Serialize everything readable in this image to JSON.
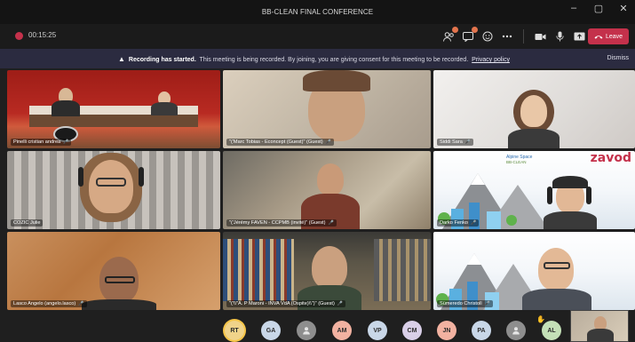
{
  "window": {
    "title": "BB-CLEAN FINAL CONFERENCE",
    "controls": [
      "–",
      "▢",
      "✕"
    ]
  },
  "toolbar": {
    "timer": "00:15:25",
    "icons": [
      "participants-icon",
      "chat-icon",
      "reactions-icon",
      "more-icon",
      "camera-icon",
      "mic-icon",
      "share-icon"
    ],
    "leave_label": "Leave"
  },
  "banner": {
    "bold": "Recording has started.",
    "text": "This meeting is being recorded. By joining, you are giving consent for this meeting to be recorded.",
    "link": "Privacy policy",
    "dismiss": "Dismiss"
  },
  "tiles": [
    {
      "name": "Pinelli cristian andrea",
      "bg": "bg-conf"
    },
    {
      "name": "\"('Marc Tobias - Econcept (Guest)\" (Guest)",
      "bg": "bg-beige"
    },
    {
      "name": "Siddi Sara",
      "bg": "bg-white"
    },
    {
      "name": "COZIC Julie",
      "bg": "bg-stripe"
    },
    {
      "name": "\"('Jérémy FAVEN - CCPMB (invité)\" (Guest)",
      "bg": "bg-wood"
    },
    {
      "name": "Darko Fenko",
      "bg": "bg-alpine"
    },
    {
      "name": "Lasco Angelo (angelo.lasco)",
      "bg": "bg-warm"
    },
    {
      "name": "\"('\\\\\"A. P Maroni - INVA VdA (Ospite)\\\\\")\" (Guest)",
      "bg": "bg-shelf"
    },
    {
      "name": "Sümeredo Christoll",
      "bg": "bg-alpine"
    }
  ],
  "participants": [
    {
      "initials": "RT",
      "color": "#f0d38a",
      "active": true
    },
    {
      "initials": "GA",
      "color": "#c9d7e8",
      "active": false
    },
    {
      "initials": "",
      "color": "#8e8e8e",
      "active": false
    },
    {
      "initials": "AM",
      "color": "#f2b2a1",
      "active": false
    },
    {
      "initials": "VP",
      "color": "#c9d7e8",
      "active": false
    },
    {
      "initials": "CM",
      "color": "#d9cfe8",
      "active": false
    },
    {
      "initials": "JN",
      "color": "#f2b2a1",
      "active": false
    },
    {
      "initials": "PA",
      "color": "#c9d7e8",
      "active": false
    },
    {
      "initials": "",
      "color": "#8e8e8e",
      "active": false
    },
    {
      "initials": "AL",
      "color": "#c4e0b7",
      "active": false
    }
  ],
  "overlay_logo": "zavod",
  "alpine_label": "Alpine Space",
  "alpine_sub": "BB-CLEAN"
}
